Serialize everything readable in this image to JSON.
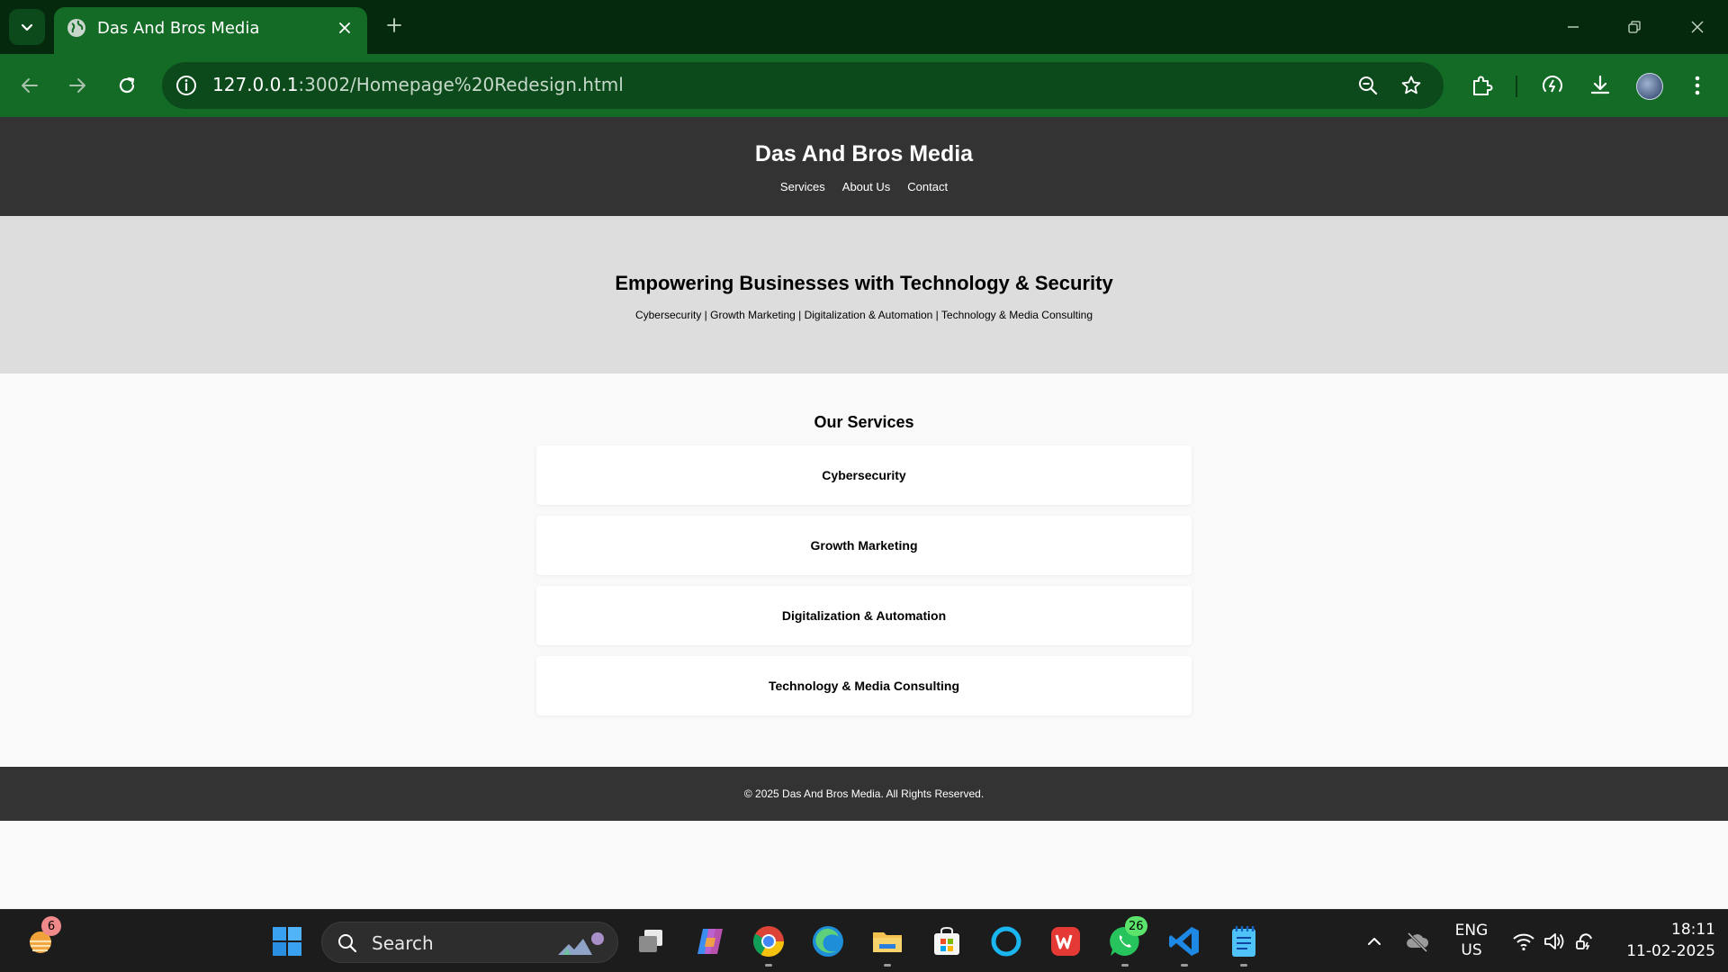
{
  "browser": {
    "tab": {
      "title": "Das And Bros Media",
      "favicon": "globe-icon"
    },
    "url": {
      "host": "127.0.0.1",
      "rest": ":3002/Homepage%20Redesign.html"
    },
    "accent_color": "#136b25"
  },
  "site": {
    "title": "Das And Bros Media",
    "nav": [
      "Services",
      "About Us",
      "Contact"
    ],
    "hero": {
      "title": "Empowering Businesses with Technology & Security",
      "subtitle": "Cybersecurity | Growth Marketing | Digitalization & Automation | Technology & Media Consulting"
    },
    "services": {
      "title": "Our Services",
      "items": [
        "Cybersecurity",
        "Growth Marketing",
        "Digitalization & Automation",
        "Technology & Media Consulting"
      ]
    },
    "footer": "© 2025 Das And Bros Media. All Rights Reserved.",
    "colors": {
      "header": "#333333",
      "hero": "#dddddd",
      "body": "#f9f9f9",
      "card": "#ffffff"
    }
  },
  "taskbar": {
    "weather_badge": "6",
    "search_placeholder": "Search",
    "whatsapp_badge": "26",
    "language": {
      "line1": "ENG",
      "line2": "US"
    },
    "time": "18:11",
    "date": "11-02-2025"
  }
}
